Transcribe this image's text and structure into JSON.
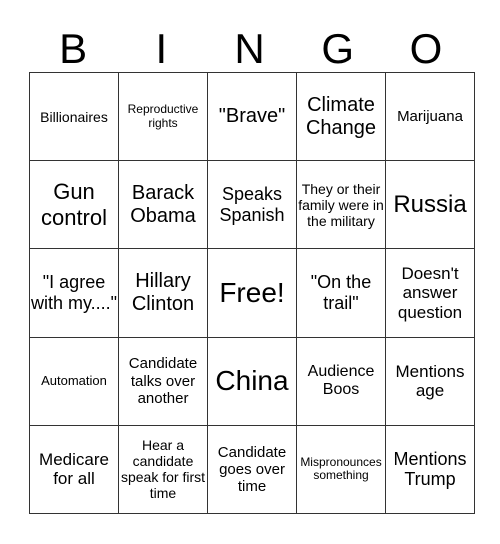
{
  "header": {
    "letters": [
      "B",
      "I",
      "N",
      "G",
      "O"
    ]
  },
  "board": {
    "rows": [
      [
        "Billionaires",
        "Reproductive rights",
        "\"Brave\"",
        "Climate Change",
        "Marijuana"
      ],
      [
        "Gun control",
        "Barack Obama",
        "Speaks Spanish",
        "They or their family were in the military",
        "Russia"
      ],
      [
        "\"I agree with my....\"",
        "Hillary Clinton",
        "Free!",
        "\"On the trail\"",
        "Doesn't answer question"
      ],
      [
        "Automation",
        "Candidate talks over another",
        "China",
        "Audience Boos",
        "Mentions age"
      ],
      [
        "Medicare for all",
        "Hear a candidate speak for first time",
        "Candidate goes over time",
        "Mispronounces something",
        "Mentions Trump"
      ]
    ]
  }
}
